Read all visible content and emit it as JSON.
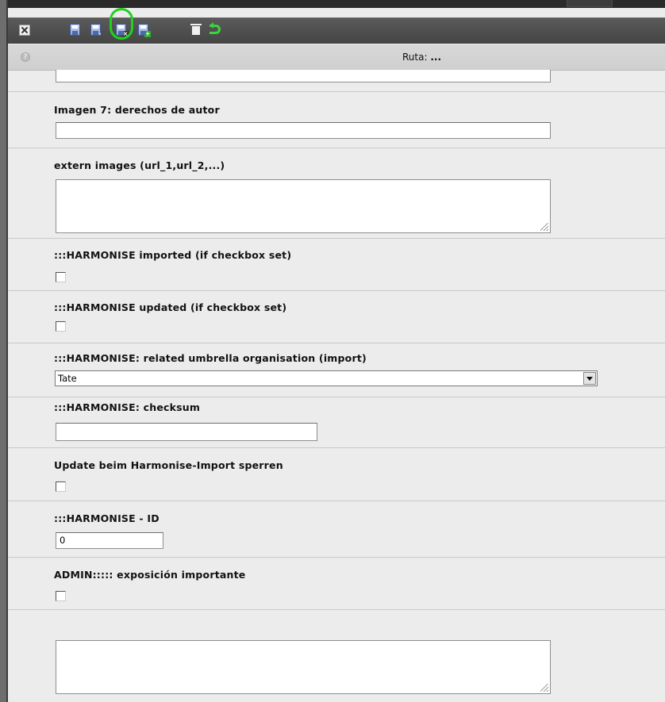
{
  "toolbar": {
    "icons": [
      "close-icon",
      "save-icon",
      "save-and-view-icon",
      "save-and-close-icon",
      "save-and-new-icon",
      "trash-icon",
      "undo-icon"
    ]
  },
  "pathbar": {
    "label": "Ruta:",
    "value": "..."
  },
  "fields": {
    "image7_copyright": {
      "label": "Imagen 7: derechos de autor",
      "value": ""
    },
    "extern_images": {
      "label": "extern images (url_1,url_2,...)",
      "value": ""
    },
    "harmonise_imported": {
      "label": ":::HARMONISE imported (if checkbox set)",
      "checked": false
    },
    "harmonise_updated": {
      "label": ":::HARMONISE updated (if checkbox set)",
      "checked": false
    },
    "harmonise_umbrella": {
      "label": ":::HARMONISE: related umbrella organisation (import)",
      "selected": "Tate"
    },
    "harmonise_checksum": {
      "label": ":::HARMONISE: checksum",
      "value": ""
    },
    "harmonise_lock": {
      "label": "Update beim Harmonise-Import sperren",
      "checked": false
    },
    "harmonise_id": {
      "label": ":::HARMONISE - ID",
      "value": "0"
    },
    "admin_important": {
      "label": "ADMIN::::: exposición importante",
      "checked": false
    },
    "unlabeled_text": {
      "label": "",
      "value": ""
    }
  },
  "colors": {
    "highlight_ring": "#1ed21e",
    "toolbar_bg": "#4e4e4e",
    "form_bg": "#ececec"
  }
}
